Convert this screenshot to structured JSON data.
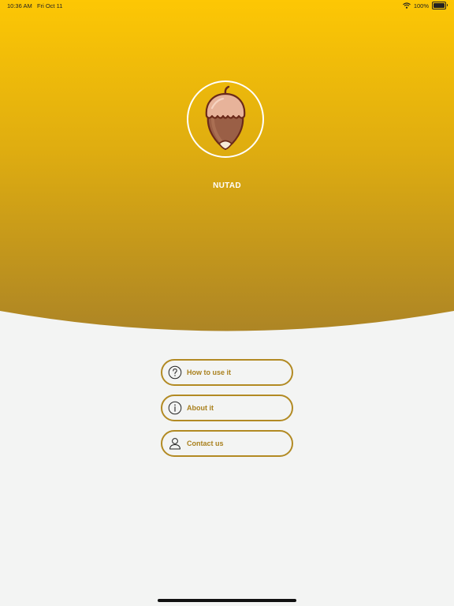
{
  "status_bar": {
    "time": "10:36 AM",
    "date": "Fri Oct 11",
    "battery_percent": "100%",
    "icons": [
      "wifi-icon",
      "battery-icon"
    ]
  },
  "app": {
    "name": "NUTAD",
    "logo_icon": "hazelnut-icon"
  },
  "menu": {
    "items": [
      {
        "label": "How to use it",
        "icon": "question-circle-icon"
      },
      {
        "label": "About it",
        "icon": "info-circle-icon"
      },
      {
        "label": "Contact us",
        "icon": "user-icon"
      }
    ]
  },
  "colors": {
    "gradient_top": "#fdc704",
    "gradient_bottom": "#ad8525",
    "accent": "#b28a23",
    "background": "#f3f4f3"
  }
}
